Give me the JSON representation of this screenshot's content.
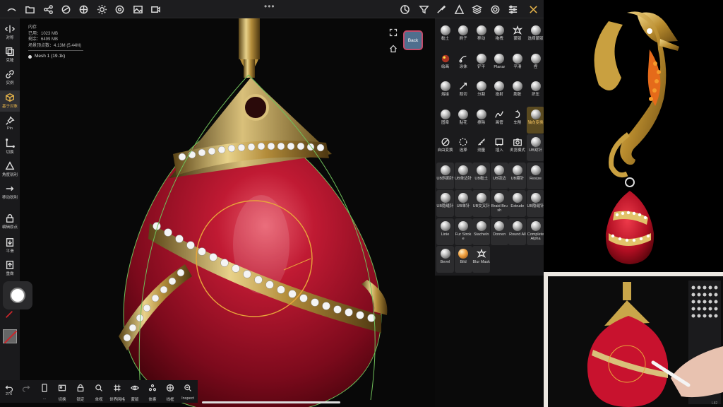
{
  "topbar": {
    "icons": [
      "logo-icon",
      "folder-icon",
      "share-icon",
      "mask-icon",
      "texture-icon",
      "light-icon",
      "material-icon",
      "image-icon",
      "video-icon"
    ],
    "right_icons": [
      "gizmo-icon",
      "filter-icon",
      "brush-icon",
      "shade-icon",
      "layers-icon",
      "settings-icon",
      "sliders-icon",
      "tools-icon"
    ],
    "more": "•••"
  },
  "stats": {
    "title": "内存",
    "used": "已用：1023 MB",
    "remaining": "剩余：6499 MB",
    "vertices": "场景顶点数：4.13M (5.44M)",
    "mesh": "Mesh 1 (19.1k)"
  },
  "leftbar": [
    {
      "label": "对称",
      "icon": "symmetry-icon"
    },
    {
      "label": "克隆",
      "icon": "clone-icon"
    },
    {
      "label": "实例",
      "icon": "instance-icon"
    },
    {
      "label": "基于对象",
      "icon": "cube-icon",
      "active": true
    },
    {
      "label": "Pin",
      "icon": "pin-icon"
    },
    {
      "label": "切换",
      "icon": "switch-icon"
    },
    {
      "label": "角度锐利",
      "icon": "triangle-icon"
    },
    {
      "label": "移动锐利",
      "icon": "move-icon"
    },
    {
      "label": "编辑原点",
      "icon": "lock-icon"
    },
    {
      "label": "平滑",
      "icon": "smooth-icon"
    },
    {
      "label": "重做",
      "icon": "redo-icon"
    }
  ],
  "viewport": {
    "back_label": "Back",
    "corner_label": "L82"
  },
  "bottombar": {
    "undo_count": "276",
    "items": [
      {
        "label": "",
        "icon": "undo-icon"
      },
      {
        "label": "",
        "icon": "redo-icon"
      },
      {
        "label": "…",
        "icon": "phone-icon"
      },
      {
        "label": "切换",
        "icon": "switch-image-icon"
      },
      {
        "label": "锁定",
        "icon": "lock-icon"
      },
      {
        "label": "单视",
        "icon": "search-icon"
      },
      {
        "label": "世界网格",
        "icon": "grid-icon"
      },
      {
        "label": "蒙版",
        "icon": "eye-icon"
      },
      {
        "label": "体素",
        "icon": "voxel-icon"
      },
      {
        "label": "线框",
        "icon": "wire-icon"
      },
      {
        "label": "Inspect",
        "icon": "inspect-icon"
      }
    ]
  },
  "palette": {
    "rows": [
      [
        {
          "label": "黏土",
          "t": "s"
        },
        {
          "label": "刷子",
          "t": "s"
        },
        {
          "label": "移动",
          "t": "s"
        },
        {
          "label": "拖拽",
          "t": "s"
        },
        {
          "label": "蒙版",
          "t": "g",
          "g": "splat"
        },
        {
          "label": "选择蒙版",
          "t": "s"
        }
      ],
      [
        {
          "label": "绘画",
          "t": "g",
          "g": "paint"
        },
        {
          "label": "涂抹",
          "t": "g",
          "g": "smudge"
        },
        {
          "label": "铲平",
          "t": "s"
        },
        {
          "label": "Planar",
          "t": "s"
        },
        {
          "label": "平滑",
          "t": "s"
        },
        {
          "label": "捏",
          "t": "s"
        }
      ],
      [
        {
          "label": "熔接",
          "t": "s"
        },
        {
          "label": "裁切",
          "t": "g",
          "g": "knife"
        },
        {
          "label": "分割",
          "t": "s"
        },
        {
          "label": "投射",
          "t": "s"
        },
        {
          "label": "膨胀",
          "t": "s"
        },
        {
          "label": "挤压",
          "t": "s"
        }
      ],
      [
        {
          "label": "图章",
          "t": "s"
        },
        {
          "label": "贴花",
          "t": "s"
        },
        {
          "label": "擦除",
          "t": "s"
        },
        {
          "label": "画管",
          "t": "g",
          "g": "tube"
        },
        {
          "label": "车削",
          "t": "g",
          "g": "lathe"
        },
        {
          "label": "轴向变换",
          "t": "s",
          "hl": true
        }
      ],
      [
        {
          "label": "自由变换",
          "t": "g",
          "g": "free"
        },
        {
          "label": "选择",
          "t": "g",
          "g": "select"
        },
        {
          "label": "测量",
          "t": "g",
          "g": "ruler"
        },
        {
          "label": "插入",
          "t": "g",
          "g": "insert"
        },
        {
          "label": "浏览模式",
          "t": "g",
          "g": "camera"
        },
        {
          "label": "UB双针",
          "t": "s",
          "box": true
        }
      ],
      [
        {
          "label": "UB斜面针",
          "t": "s",
          "box": true
        },
        {
          "label": "UB单边针",
          "t": "s",
          "box": true
        },
        {
          "label": "UB黏土",
          "t": "s",
          "box": true
        },
        {
          "label": "UB锁边",
          "t": "s",
          "box": true
        },
        {
          "label": "UB藏针",
          "t": "s",
          "box": true
        },
        {
          "label": "Resize",
          "t": "s",
          "box": true
        }
      ],
      [
        {
          "label": "UB隐缝针",
          "t": "s",
          "box": true
        },
        {
          "label": "UB单针",
          "t": "s",
          "box": true
        },
        {
          "label": "UB交叉针",
          "t": "s",
          "box": true
        },
        {
          "label": "Braid Brush",
          "t": "s",
          "box": true
        },
        {
          "label": "Extrude",
          "t": "s",
          "box": true
        },
        {
          "label": "UB隐缝针",
          "t": "s",
          "box": true
        }
      ],
      [
        {
          "label": "Linie",
          "t": "s",
          "box": true
        },
        {
          "label": "Fur Stroke",
          "t": "s",
          "box": true
        },
        {
          "label": "Stacheln",
          "t": "s",
          "box": true
        },
        {
          "label": "Dornen",
          "t": "s",
          "box": true
        },
        {
          "label": "Round All",
          "t": "s",
          "box": true
        },
        {
          "label": "Complete Alpha",
          "t": "s",
          "box": true
        }
      ],
      [
        {
          "label": "Bevel",
          "t": "s",
          "box": true
        },
        {
          "label": "Bild",
          "t": "s",
          "box": true,
          "orange": true
        },
        {
          "label": "Blur Mask",
          "t": "g",
          "g": "splat",
          "box": true
        }
      ]
    ]
  },
  "colors": {
    "accent": "#e8b54a",
    "gem_red": "#b4142a",
    "gold": "#c9a64a",
    "back_button": "#4f6f8e"
  }
}
